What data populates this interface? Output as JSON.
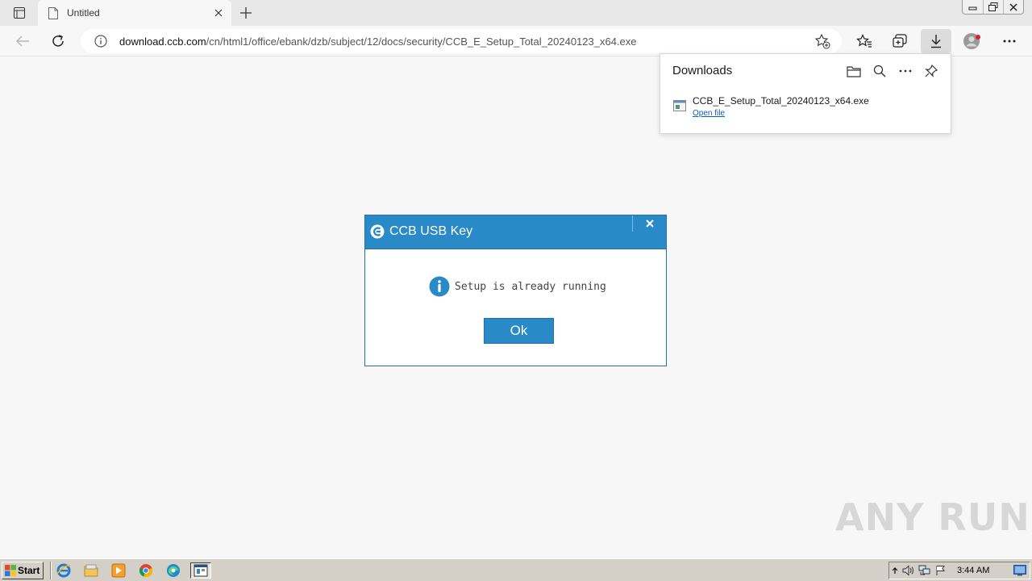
{
  "browser": {
    "tab": {
      "title": "Untitled"
    },
    "address": {
      "host": "download.ccb.com",
      "path": "/cn/html1/office/ebank/dzb/subject/12/docs/security/CCB_E_Setup_Total_20240123_x64.exe"
    }
  },
  "downloads": {
    "title": "Downloads",
    "items": [
      {
        "filename": "CCB_E_Setup_Total_20240123_x64.exe",
        "action": "Open file"
      }
    ]
  },
  "dialog": {
    "title": "CCB USB Key",
    "message": "Setup is already running",
    "ok_label": "Ok"
  },
  "watermark": {
    "text": "ANY RUN"
  },
  "taskbar": {
    "start_label": "Start",
    "time": "3:44 AM"
  },
  "colors": {
    "dialog_accent": "#2a89c7",
    "link": "#0a5fc0"
  },
  "icons": {
    "taskbar_apps": [
      "internet-explorer-icon",
      "folder-icon",
      "media-player-icon",
      "chrome-icon",
      "edge-icon",
      "setup-icon"
    ],
    "tray": [
      "chevron-up-icon",
      "speaker-icon",
      "network-icon",
      "flag-icon"
    ]
  }
}
